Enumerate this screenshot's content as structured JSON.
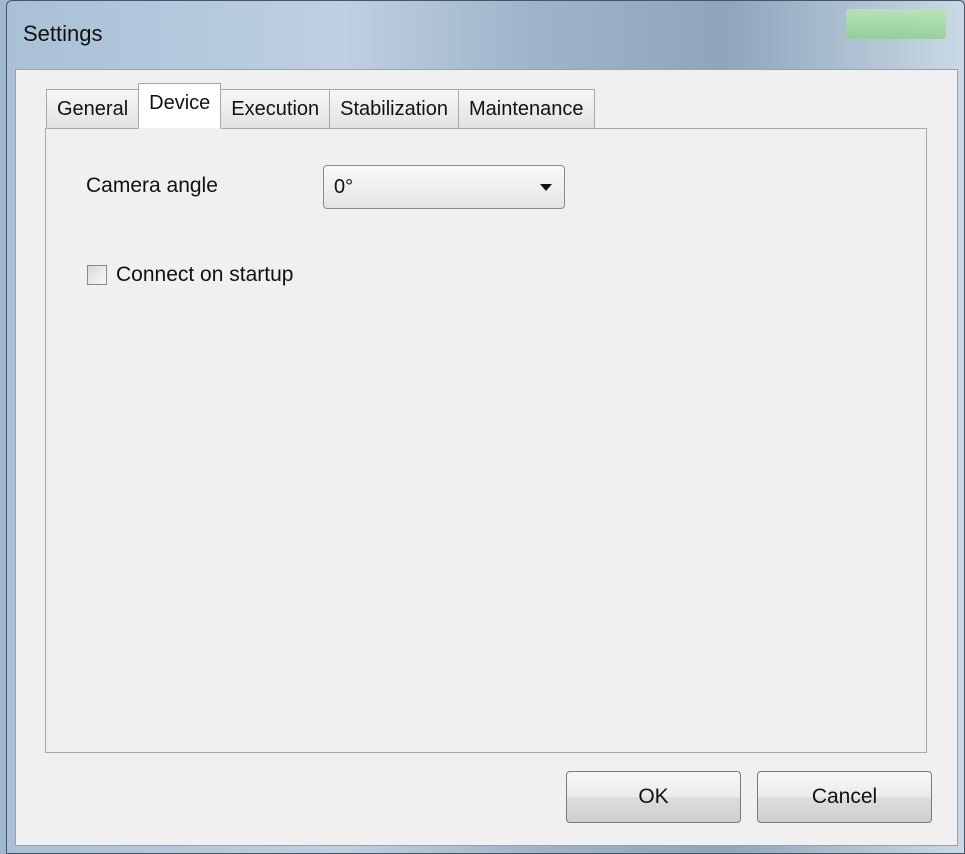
{
  "window": {
    "title": "Settings"
  },
  "tabs": [
    {
      "label": "General",
      "active": false
    },
    {
      "label": "Device",
      "active": true
    },
    {
      "label": "Execution",
      "active": false
    },
    {
      "label": "Stabilization",
      "active": false
    },
    {
      "label": "Maintenance",
      "active": false
    }
  ],
  "device": {
    "camera_angle_label": "Camera angle",
    "camera_angle_value": "0°",
    "connect_on_startup_label": "Connect on startup",
    "connect_on_startup_checked": false
  },
  "buttons": {
    "ok": "OK",
    "cancel": "Cancel"
  },
  "colors": {
    "title_bar": "#a9c0d6",
    "client": "#f0f0f0",
    "active_tab": "#ffffff"
  },
  "icons": {
    "dropdown": "chevron-down-icon"
  }
}
